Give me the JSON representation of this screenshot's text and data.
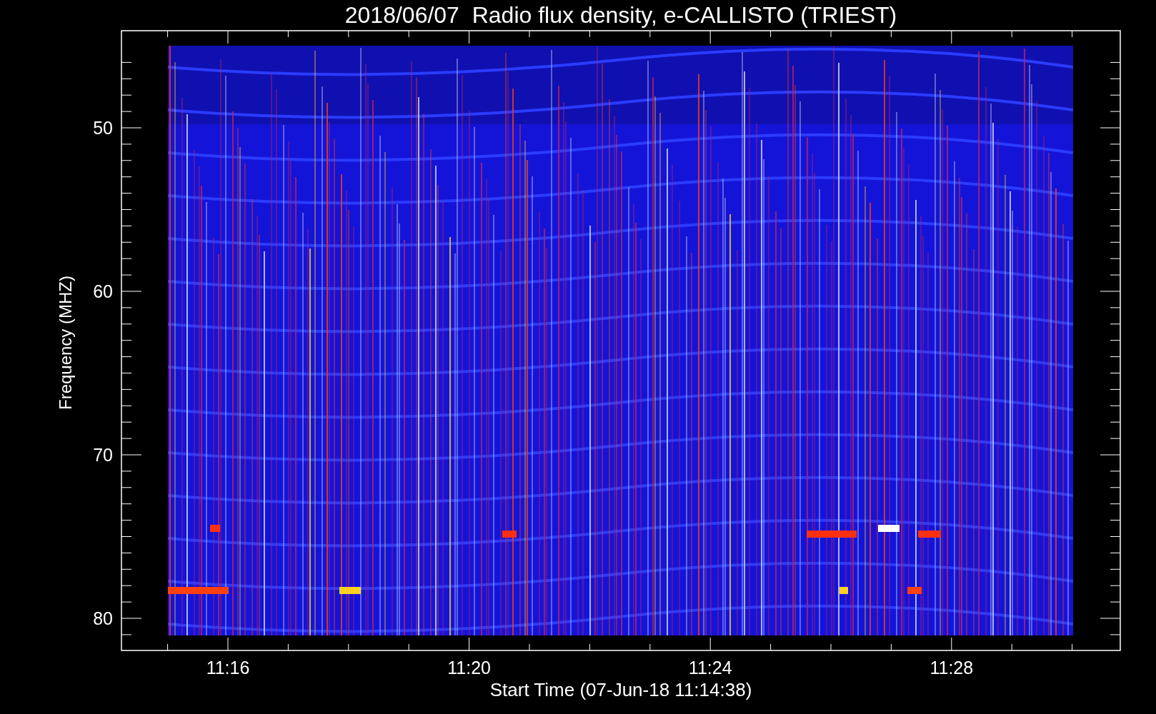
{
  "title": "2018/06/07  Radio flux density, e-CALLISTO (TRIEST)",
  "xlabel": "Start Time (07-Jun-18 11:14:38)",
  "ylabel": "Frequency (MHZ)",
  "xticks": [
    "11:16",
    "11:20",
    "11:24",
    "11:28"
  ],
  "yticks": [
    "50",
    "60",
    "70",
    "80"
  ]
}
